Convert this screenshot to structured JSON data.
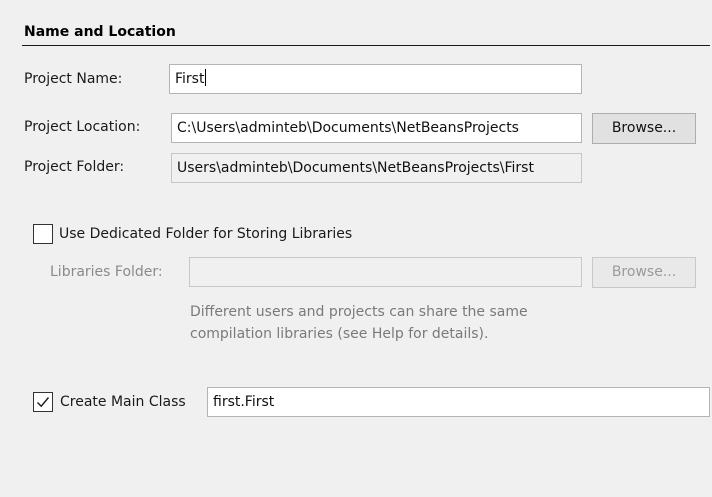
{
  "section": {
    "title": "Name and Location"
  },
  "project_name": {
    "label": "Project Name:",
    "value": "First"
  },
  "project_location": {
    "label": "Project Location:",
    "value": "C:\\Users\\adminteb\\Documents\\NetBeansProjects",
    "browse_label": "Browse..."
  },
  "project_folder": {
    "label": "Project Folder:",
    "value": "Users\\adminteb\\Documents\\NetBeansProjects\\First"
  },
  "dedicated_folder": {
    "checkbox_label": "Use Dedicated Folder for Storing Libraries",
    "checked": false,
    "libraries_label": "Libraries Folder:",
    "libraries_value": "",
    "browse_label": "Browse...",
    "hint_line1": "Different users and projects can share the same",
    "hint_line2": "compilation libraries (see Help for details)."
  },
  "main_class": {
    "checkbox_label": "Create Main Class",
    "checked": true,
    "value": "first.First"
  },
  "colors": {
    "background": "#f0f0f0",
    "disabled_text": "#8a8a8a"
  }
}
